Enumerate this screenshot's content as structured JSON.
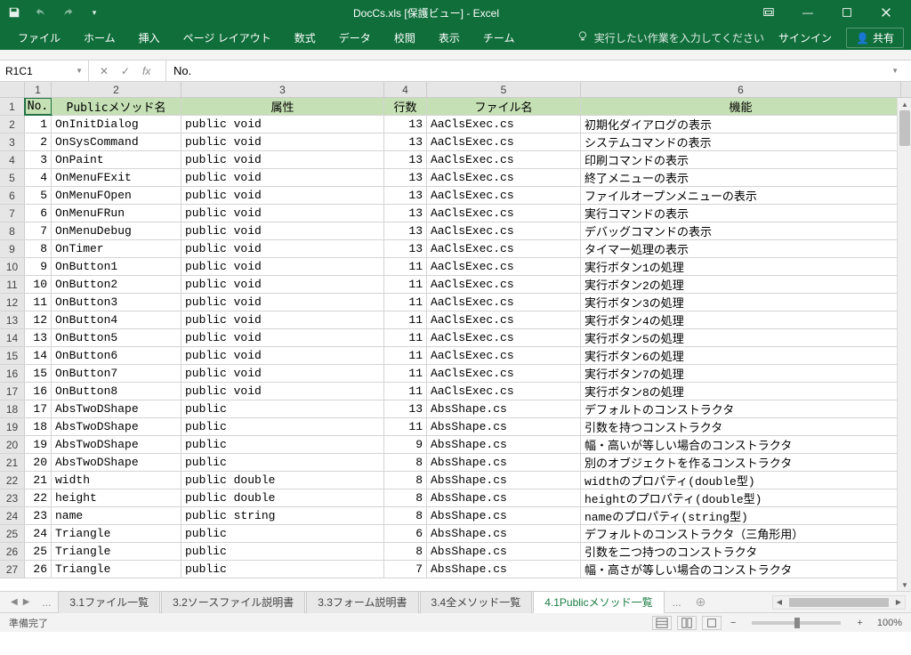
{
  "title": "DocCs.xls  [保護ビュー] - Excel",
  "qat": {
    "save": "save",
    "undo": "undo",
    "redo": "redo",
    "custom": "▾"
  },
  "win": {
    "ropt": "⎘",
    "min": "—",
    "max": "☐",
    "close": "✕"
  },
  "tabs": [
    "ファイル",
    "ホーム",
    "挿入",
    "ページ レイアウト",
    "数式",
    "データ",
    "校閲",
    "表示",
    "チーム"
  ],
  "tellme": "実行したい作業を入力してください",
  "signin": "サインイン",
  "share": "共有",
  "namebox": "R1C1",
  "fx_value": "No.",
  "col_nums": [
    "1",
    "2",
    "3",
    "4",
    "5",
    "6"
  ],
  "headers": [
    "No.",
    "Publicメソッド名",
    "属性",
    "行数",
    "ファイル名",
    "機能"
  ],
  "rows": [
    {
      "n": "1",
      "m": "OnInitDialog",
      "a": "public void",
      "l": "13",
      "f": "AaClsExec.cs",
      "d": "初期化ダイアログの表示"
    },
    {
      "n": "2",
      "m": "OnSysCommand",
      "a": "public void",
      "l": "13",
      "f": "AaClsExec.cs",
      "d": "システムコマンドの表示"
    },
    {
      "n": "3",
      "m": "OnPaint",
      "a": "public void",
      "l": "13",
      "f": "AaClsExec.cs",
      "d": "印刷コマンドの表示"
    },
    {
      "n": "4",
      "m": "OnMenuFExit",
      "a": "public void",
      "l": "13",
      "f": "AaClsExec.cs",
      "d": "終了メニューの表示"
    },
    {
      "n": "5",
      "m": "OnMenuFOpen",
      "a": "public void",
      "l": "13",
      "f": "AaClsExec.cs",
      "d": "ファイルオープンメニューの表示"
    },
    {
      "n": "6",
      "m": "OnMenuFRun",
      "a": "public void",
      "l": "13",
      "f": "AaClsExec.cs",
      "d": "実行コマンドの表示"
    },
    {
      "n": "7",
      "m": "OnMenuDebug",
      "a": "public void",
      "l": "13",
      "f": "AaClsExec.cs",
      "d": "デバッグコマンドの表示"
    },
    {
      "n": "8",
      "m": "OnTimer",
      "a": "public void",
      "l": "13",
      "f": "AaClsExec.cs",
      "d": "タイマー処理の表示"
    },
    {
      "n": "9",
      "m": "OnButton1",
      "a": "public void",
      "l": "11",
      "f": "AaClsExec.cs",
      "d": "実行ボタン1の処理"
    },
    {
      "n": "10",
      "m": "OnButton2",
      "a": "public void",
      "l": "11",
      "f": "AaClsExec.cs",
      "d": "実行ボタン2の処理"
    },
    {
      "n": "11",
      "m": "OnButton3",
      "a": "public void",
      "l": "11",
      "f": "AaClsExec.cs",
      "d": "実行ボタン3の処理"
    },
    {
      "n": "12",
      "m": "OnButton4",
      "a": "public void",
      "l": "11",
      "f": "AaClsExec.cs",
      "d": "実行ボタン4の処理"
    },
    {
      "n": "13",
      "m": "OnButton5",
      "a": "public void",
      "l": "11",
      "f": "AaClsExec.cs",
      "d": "実行ボタン5の処理"
    },
    {
      "n": "14",
      "m": "OnButton6",
      "a": "public void",
      "l": "11",
      "f": "AaClsExec.cs",
      "d": "実行ボタン6の処理"
    },
    {
      "n": "15",
      "m": "OnButton7",
      "a": "public void",
      "l": "11",
      "f": "AaClsExec.cs",
      "d": "実行ボタン7の処理"
    },
    {
      "n": "16",
      "m": "OnButton8",
      "a": "public void",
      "l": "11",
      "f": "AaClsExec.cs",
      "d": "実行ボタン8の処理"
    },
    {
      "n": "17",
      "m": "AbsTwoDShape",
      "a": "public",
      "l": "13",
      "f": "AbsShape.cs",
      "d": "デフォルトのコンストラクタ"
    },
    {
      "n": "18",
      "m": "AbsTwoDShape",
      "a": "public",
      "l": "11",
      "f": "AbsShape.cs",
      "d": "引数を持つコンストラクタ"
    },
    {
      "n": "19",
      "m": "AbsTwoDShape",
      "a": "public",
      "l": "9",
      "f": "AbsShape.cs",
      "d": "幅・高いが等しい場合のコンストラクタ"
    },
    {
      "n": "20",
      "m": "AbsTwoDShape",
      "a": "public",
      "l": "8",
      "f": "AbsShape.cs",
      "d": "別のオブジェクトを作るコンストラクタ"
    },
    {
      "n": "21",
      "m": "width",
      "a": "public double",
      "l": "8",
      "f": "AbsShape.cs",
      "d": "widthのプロパティ(double型)"
    },
    {
      "n": "22",
      "m": "height",
      "a": "public double",
      "l": "8",
      "f": "AbsShape.cs",
      "d": "heightのプロパティ(double型)"
    },
    {
      "n": "23",
      "m": "name",
      "a": "public string",
      "l": "8",
      "f": "AbsShape.cs",
      "d": "nameのプロパティ(string型)"
    },
    {
      "n": "24",
      "m": "Triangle",
      "a": "public",
      "l": "6",
      "f": "AbsShape.cs",
      "d": "デフォルトのコンストラクタ（三角形用）"
    },
    {
      "n": "25",
      "m": "Triangle",
      "a": "public",
      "l": "8",
      "f": "AbsShape.cs",
      "d": "引数を二つ持つのコンストラクタ"
    },
    {
      "n": "26",
      "m": "Triangle",
      "a": "public",
      "l": "7",
      "f": "AbsShape.cs",
      "d": "幅・高さが等しい場合のコンストラクタ"
    }
  ],
  "sheets": [
    "3.1ファイル一覧",
    "3.2ソースファイル説明書",
    "3.3フォーム説明書",
    "3.4全メソッド一覧",
    "4.1Publicメソッド一覧"
  ],
  "active_sheet": 4,
  "more": "...",
  "status": "準備完了",
  "zoom": "100%"
}
